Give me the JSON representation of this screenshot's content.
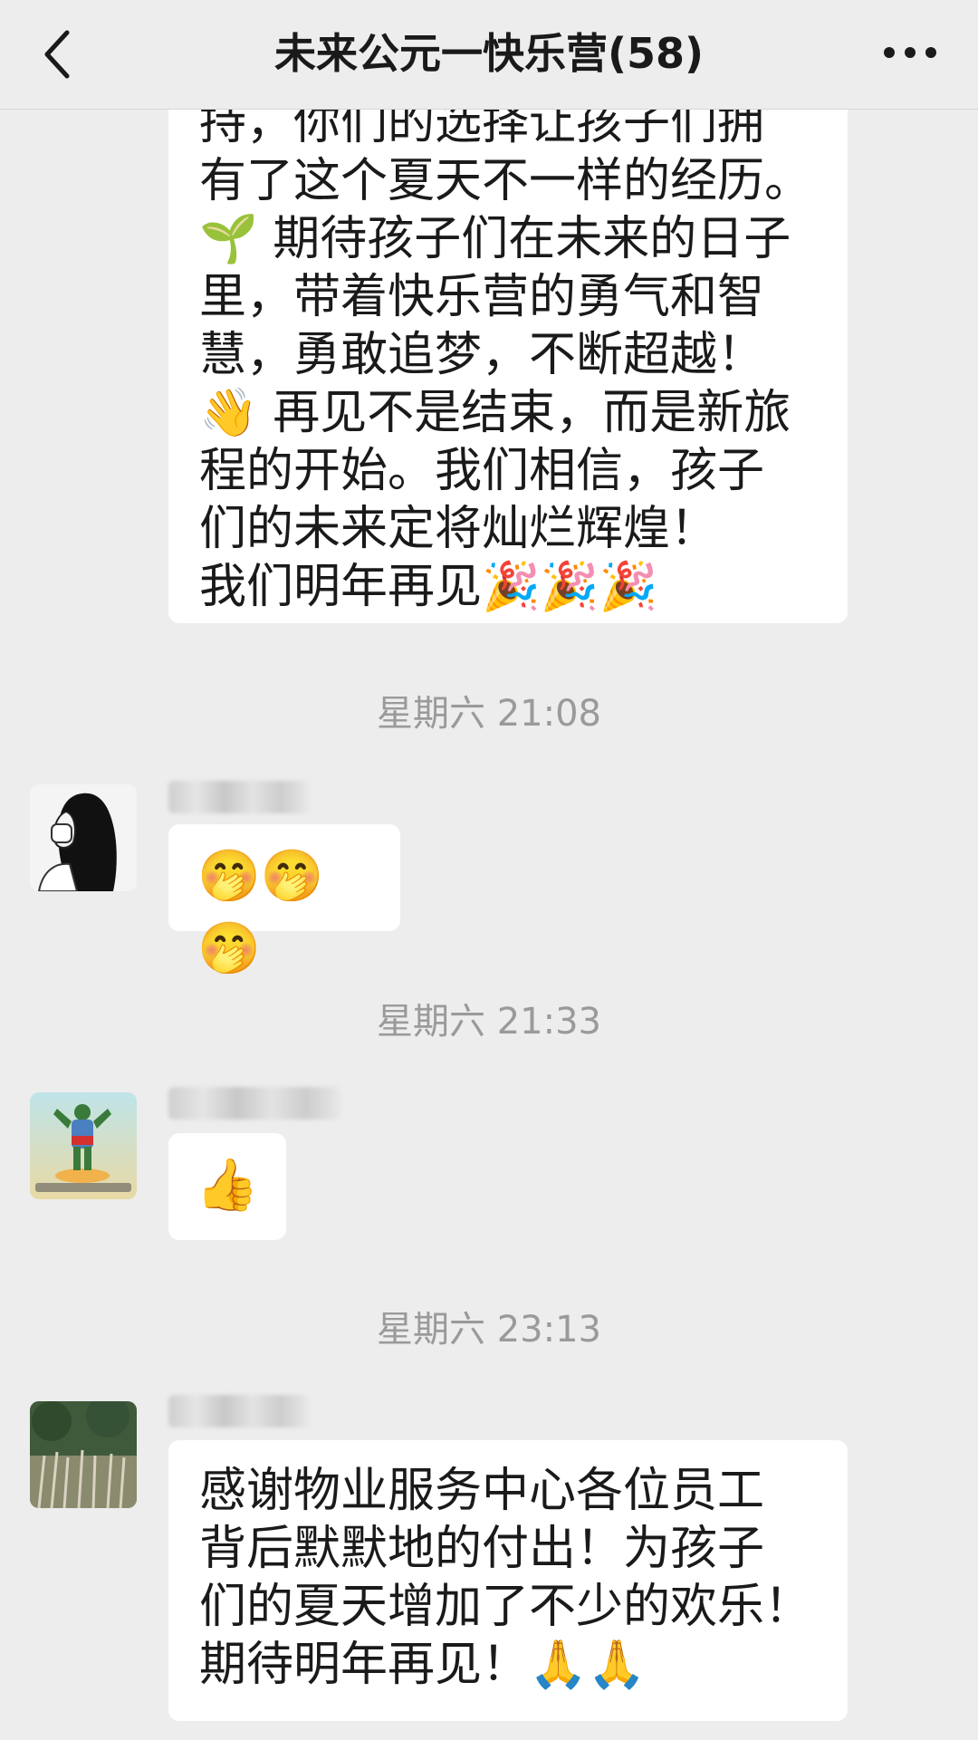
{
  "header": {
    "title": "未来公元一快乐营(58)"
  },
  "messages": {
    "first_bubble_lines": [
      "持，你们的选择让孩子们拥",
      "有了这个夏天不一样的经历。",
      "🌱 期待孩子们在未来的日子",
      "里，带着快乐营的勇气和智",
      "慧，勇敢追梦，不断超越！",
      "👋 再见不是结束，而是新旅",
      "程的开始。我们相信，孩子",
      "们的未来定将灿烂辉煌！",
      "我们明年再见🎉🎉🎉"
    ],
    "time_1": "星期六 21:08",
    "msg_1_emoji": "🤭🤭🤭",
    "time_2": "星期六 21:33",
    "msg_2_emoji": "👍",
    "time_3": "星期六 23:13",
    "last_bubble_lines": [
      "感谢物业服务中心各位员工",
      "背后默默地的付出！为孩子",
      "们的夏天增加了不少的欢乐！",
      "期待明年再见！🙏🙏"
    ]
  },
  "icons": {
    "back": "chevron-left-icon",
    "more": "more-dots-icon"
  },
  "colors": {
    "background": "#ededed",
    "bubble": "#ffffff",
    "time_text": "#9a9a9a",
    "title_text": "#1a1a1a"
  }
}
